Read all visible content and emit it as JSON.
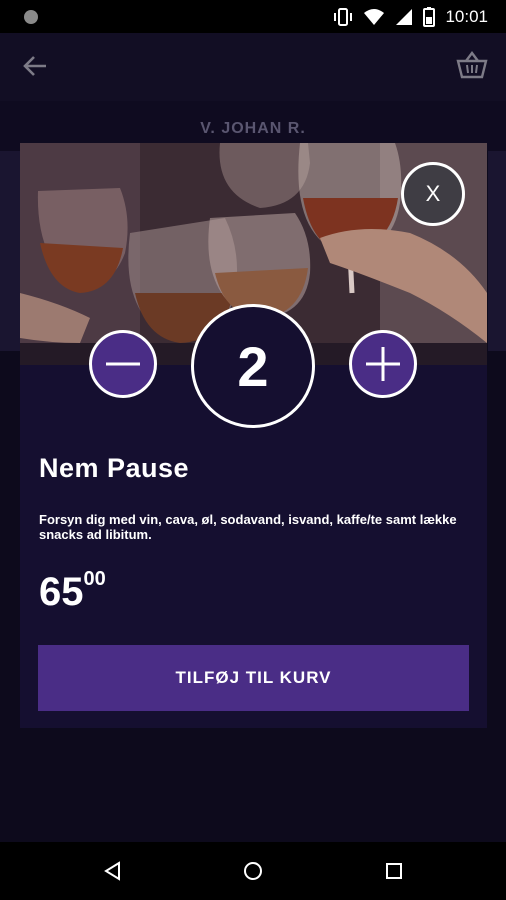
{
  "status_bar": {
    "time": "10:01",
    "icons": [
      "notification-dot-icon",
      "vibrate-icon",
      "wifi-icon",
      "signal-icon",
      "battery-icon"
    ]
  },
  "header": {
    "back_icon": "arrow-left-icon",
    "basket_icon": "basket-icon",
    "venue_title": "V. JOHAN R."
  },
  "modal": {
    "close_label": "X",
    "quantity": "2",
    "product_name": "Nem Pause",
    "description": "Forsyn dig med vin, cava, øl, sodavand, isvand, kaffe/te samt lække snacks ad libitum.",
    "price_main": "65",
    "price_cents": "00",
    "add_button_label": "TILFØJ TIL KURV"
  },
  "nav_bar": {
    "icons": [
      "back-triangle-icon",
      "home-circle-icon",
      "recents-square-icon"
    ]
  },
  "colors": {
    "background": "#0d0a1c",
    "modal": "#150f30",
    "accent": "#4a2d86"
  }
}
